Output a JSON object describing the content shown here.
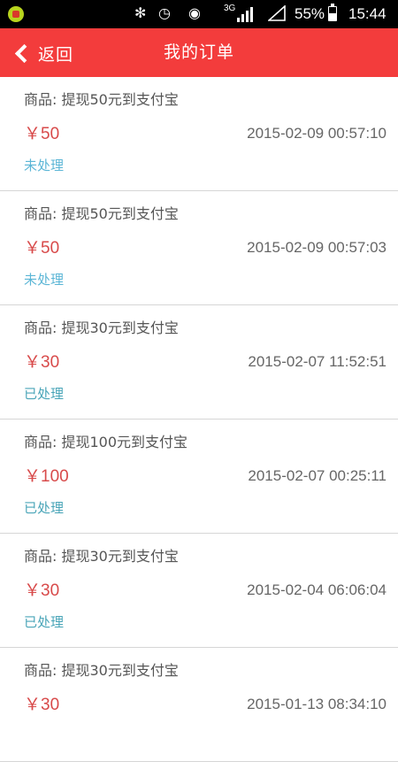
{
  "status_bar": {
    "battery": "55%",
    "time": "15:44",
    "network": "3G",
    "battery_level": 0.55
  },
  "header": {
    "back_label": "返回",
    "title": "我的订单"
  },
  "orders": [
    {
      "product": "商品: 提现50元到支付宝",
      "price": "￥50",
      "time": "2015-02-09 00:57:10",
      "status": "未处理",
      "status_type": "pending"
    },
    {
      "product": "商品: 提现50元到支付宝",
      "price": "￥50",
      "time": "2015-02-09 00:57:03",
      "status": "未处理",
      "status_type": "pending"
    },
    {
      "product": "商品: 提现30元到支付宝",
      "price": "￥30",
      "time": "2015-02-07 11:52:51",
      "status": "已处理",
      "status_type": "done"
    },
    {
      "product": "商品: 提现100元到支付宝",
      "price": "￥100",
      "time": "2015-02-07 00:25:11",
      "status": "已处理",
      "status_type": "done"
    },
    {
      "product": "商品: 提现30元到支付宝",
      "price": "￥30",
      "time": "2015-02-04 06:06:04",
      "status": "已处理",
      "status_type": "done"
    },
    {
      "product": "商品: 提现30元到支付宝",
      "price": "￥30",
      "time": "2015-01-13 08:34:10",
      "status": "",
      "status_type": "done"
    }
  ],
  "colors": {
    "header_bg": "#f33c3c",
    "price": "#d84a4a",
    "status_pending": "#5cb6d6",
    "status_done": "#4aa5b8"
  }
}
